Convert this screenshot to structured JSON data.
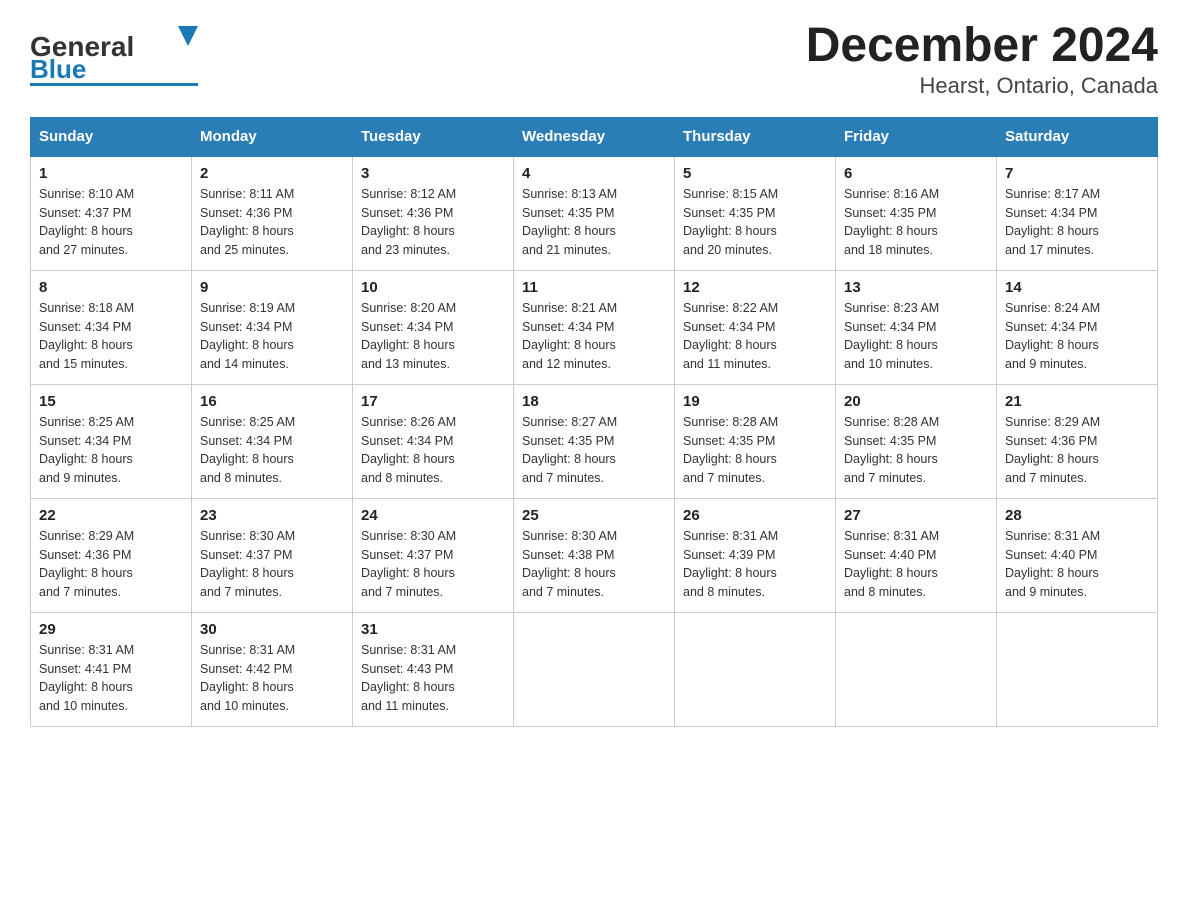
{
  "header": {
    "logo_text_general": "General",
    "logo_text_blue": "Blue",
    "title": "December 2024",
    "subtitle": "Hearst, Ontario, Canada"
  },
  "columns": [
    "Sunday",
    "Monday",
    "Tuesday",
    "Wednesday",
    "Thursday",
    "Friday",
    "Saturday"
  ],
  "weeks": [
    [
      {
        "day": "1",
        "sunrise": "8:10 AM",
        "sunset": "4:37 PM",
        "daylight": "8 hours and 27 minutes."
      },
      {
        "day": "2",
        "sunrise": "8:11 AM",
        "sunset": "4:36 PM",
        "daylight": "8 hours and 25 minutes."
      },
      {
        "day": "3",
        "sunrise": "8:12 AM",
        "sunset": "4:36 PM",
        "daylight": "8 hours and 23 minutes."
      },
      {
        "day": "4",
        "sunrise": "8:13 AM",
        "sunset": "4:35 PM",
        "daylight": "8 hours and 21 minutes."
      },
      {
        "day": "5",
        "sunrise": "8:15 AM",
        "sunset": "4:35 PM",
        "daylight": "8 hours and 20 minutes."
      },
      {
        "day": "6",
        "sunrise": "8:16 AM",
        "sunset": "4:35 PM",
        "daylight": "8 hours and 18 minutes."
      },
      {
        "day": "7",
        "sunrise": "8:17 AM",
        "sunset": "4:34 PM",
        "daylight": "8 hours and 17 minutes."
      }
    ],
    [
      {
        "day": "8",
        "sunrise": "8:18 AM",
        "sunset": "4:34 PM",
        "daylight": "8 hours and 15 minutes."
      },
      {
        "day": "9",
        "sunrise": "8:19 AM",
        "sunset": "4:34 PM",
        "daylight": "8 hours and 14 minutes."
      },
      {
        "day": "10",
        "sunrise": "8:20 AM",
        "sunset": "4:34 PM",
        "daylight": "8 hours and 13 minutes."
      },
      {
        "day": "11",
        "sunrise": "8:21 AM",
        "sunset": "4:34 PM",
        "daylight": "8 hours and 12 minutes."
      },
      {
        "day": "12",
        "sunrise": "8:22 AM",
        "sunset": "4:34 PM",
        "daylight": "8 hours and 11 minutes."
      },
      {
        "day": "13",
        "sunrise": "8:23 AM",
        "sunset": "4:34 PM",
        "daylight": "8 hours and 10 minutes."
      },
      {
        "day": "14",
        "sunrise": "8:24 AM",
        "sunset": "4:34 PM",
        "daylight": "8 hours and 9 minutes."
      }
    ],
    [
      {
        "day": "15",
        "sunrise": "8:25 AM",
        "sunset": "4:34 PM",
        "daylight": "8 hours and 9 minutes."
      },
      {
        "day": "16",
        "sunrise": "8:25 AM",
        "sunset": "4:34 PM",
        "daylight": "8 hours and 8 minutes."
      },
      {
        "day": "17",
        "sunrise": "8:26 AM",
        "sunset": "4:34 PM",
        "daylight": "8 hours and 8 minutes."
      },
      {
        "day": "18",
        "sunrise": "8:27 AM",
        "sunset": "4:35 PM",
        "daylight": "8 hours and 7 minutes."
      },
      {
        "day": "19",
        "sunrise": "8:28 AM",
        "sunset": "4:35 PM",
        "daylight": "8 hours and 7 minutes."
      },
      {
        "day": "20",
        "sunrise": "8:28 AM",
        "sunset": "4:35 PM",
        "daylight": "8 hours and 7 minutes."
      },
      {
        "day": "21",
        "sunrise": "8:29 AM",
        "sunset": "4:36 PM",
        "daylight": "8 hours and 7 minutes."
      }
    ],
    [
      {
        "day": "22",
        "sunrise": "8:29 AM",
        "sunset": "4:36 PM",
        "daylight": "8 hours and 7 minutes."
      },
      {
        "day": "23",
        "sunrise": "8:30 AM",
        "sunset": "4:37 PM",
        "daylight": "8 hours and 7 minutes."
      },
      {
        "day": "24",
        "sunrise": "8:30 AM",
        "sunset": "4:37 PM",
        "daylight": "8 hours and 7 minutes."
      },
      {
        "day": "25",
        "sunrise": "8:30 AM",
        "sunset": "4:38 PM",
        "daylight": "8 hours and 7 minutes."
      },
      {
        "day": "26",
        "sunrise": "8:31 AM",
        "sunset": "4:39 PM",
        "daylight": "8 hours and 8 minutes."
      },
      {
        "day": "27",
        "sunrise": "8:31 AM",
        "sunset": "4:40 PM",
        "daylight": "8 hours and 8 minutes."
      },
      {
        "day": "28",
        "sunrise": "8:31 AM",
        "sunset": "4:40 PM",
        "daylight": "8 hours and 9 minutes."
      }
    ],
    [
      {
        "day": "29",
        "sunrise": "8:31 AM",
        "sunset": "4:41 PM",
        "daylight": "8 hours and 10 minutes."
      },
      {
        "day": "30",
        "sunrise": "8:31 AM",
        "sunset": "4:42 PM",
        "daylight": "8 hours and 10 minutes."
      },
      {
        "day": "31",
        "sunrise": "8:31 AM",
        "sunset": "4:43 PM",
        "daylight": "8 hours and 11 minutes."
      },
      null,
      null,
      null,
      null
    ]
  ],
  "labels": {
    "sunrise": "Sunrise:",
    "sunset": "Sunset:",
    "daylight": "Daylight:"
  }
}
